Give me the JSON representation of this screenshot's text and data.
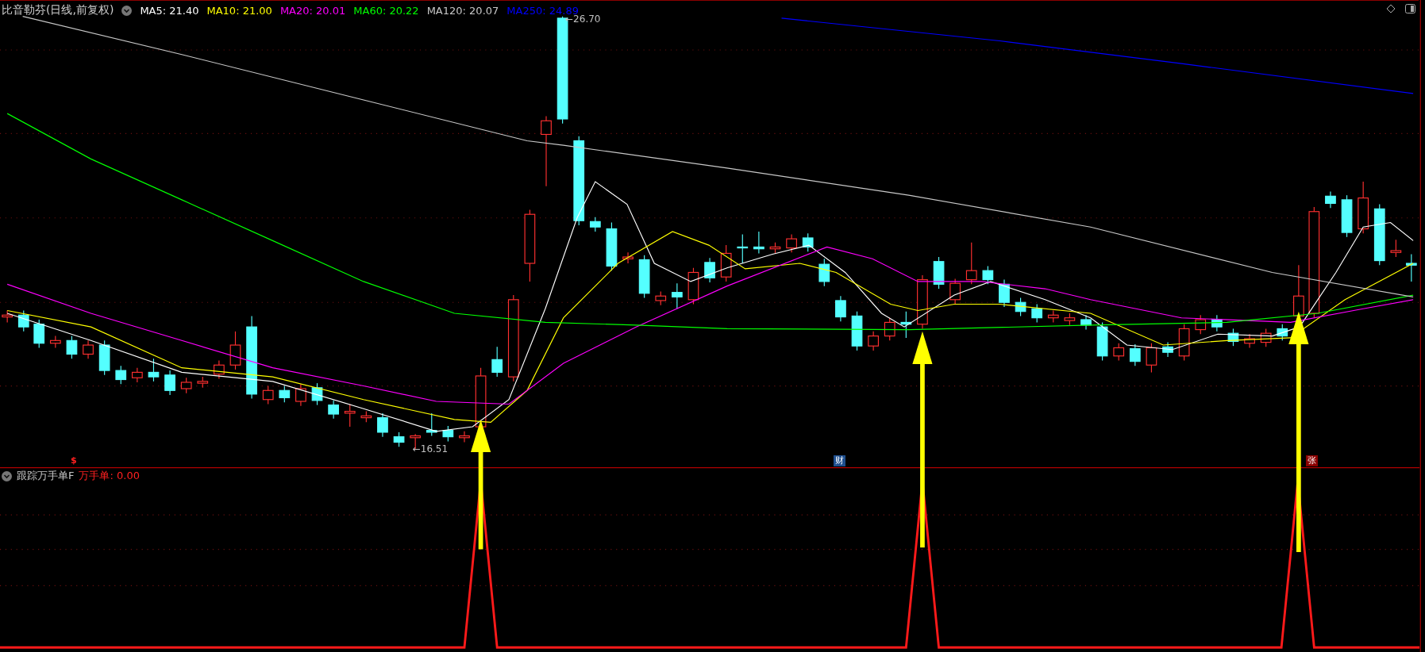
{
  "header": {
    "title": "比音勒芬(日线,前复权)",
    "legend": [
      {
        "label": "MA5: 21.40",
        "color": "#ffffff"
      },
      {
        "label": "MA10: 21.00",
        "color": "#ffff00"
      },
      {
        "label": "MA20: 20.01",
        "color": "#ff00ff"
      },
      {
        "label": "MA60: 20.22",
        "color": "#00ff00"
      },
      {
        "label": "MA120: 20.07",
        "color": "#c8c8c8"
      },
      {
        "label": "MA250: 24.89",
        "color": "#0000ff"
      }
    ]
  },
  "price_labels": [
    {
      "text": "←26.70"
    },
    {
      "text": "←16.51"
    }
  ],
  "markers": [
    {
      "kind": "symbol",
      "text": "$",
      "color": "#ff2020"
    },
    {
      "kind": "badge",
      "text": "财",
      "color": "#1e4f8f"
    },
    {
      "kind": "badge",
      "text": "张",
      "color": "#8b0000"
    }
  ],
  "indicator": {
    "title": "跟踪万手单F",
    "value": "万手单: 0.00"
  }
}
